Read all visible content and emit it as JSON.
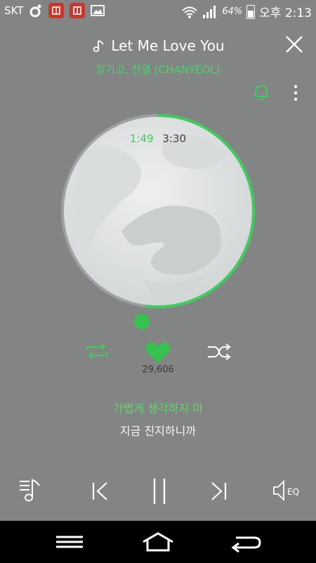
{
  "status_bar": {
    "carrier": "SKT",
    "battery": "64%",
    "time": "오후 2:13",
    "icons": [
      "nate-icon",
      "app-icon",
      "app-icon",
      "gallery-icon",
      "wifi-icon",
      "signal-icon",
      "battery-charging-icon"
    ]
  },
  "song": {
    "title": "Let Me Love You",
    "artist": "정기고, 찬열 (CHANYEOL)"
  },
  "playback": {
    "current_time": "1:49",
    "separator": "·",
    "total_time": "3:30",
    "progress": 0.519
  },
  "likes": "29,606",
  "lyrics": {
    "current": "가볍게 생각하지 마",
    "next": "지금 진지하니까"
  },
  "colors": {
    "background": "#838585",
    "accent": "#3fcc5d",
    "navbar": "#000000"
  }
}
